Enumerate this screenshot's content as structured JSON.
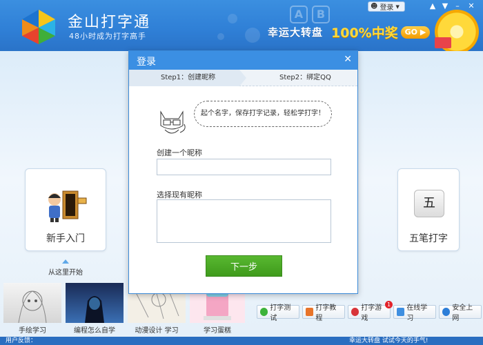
{
  "header": {
    "app_title": "金山打字通",
    "app_subtitle": "48小时成为打字高手",
    "login_label": "登录",
    "promo_text": "幸运大转盘",
    "promo_percent": "100%中奖",
    "promo_button": "GO"
  },
  "main": {
    "card_left_label": "新手入门",
    "card_right_label": "五笔打字",
    "card_right_key": "五",
    "start_hint": "从这里开始",
    "thumbnails": [
      {
        "label": "手绘学习"
      },
      {
        "label": "编程怎么自学"
      },
      {
        "label": "动漫设计 学习"
      },
      {
        "label": "学习蛋糕"
      }
    ],
    "tools": [
      {
        "label": "打字测试"
      },
      {
        "label": "打字教程"
      },
      {
        "label": "打字游戏"
      },
      {
        "label": "在线学习"
      },
      {
        "label": "安全上网"
      }
    ],
    "games_badge": "1"
  },
  "footer": {
    "feedback": "用户反馈：",
    "ticker": "幸运大转盘 试试今天的手气!"
  },
  "dialog": {
    "title": "登录",
    "step1": "Step1：创建昵称",
    "step2": "Step2：绑定QQ",
    "speech": "起个名字，保存打字记录，轻松学打字！",
    "create_label": "创建一个昵称",
    "create_value": "",
    "select_label": "选择现有昵称",
    "next_button": "下一步"
  },
  "colors": {
    "header_blue": "#2f7fd6",
    "dialog_title_blue": "#3b8fe3",
    "next_green": "#4aa824",
    "promo_yellow": "#ffd93a"
  }
}
